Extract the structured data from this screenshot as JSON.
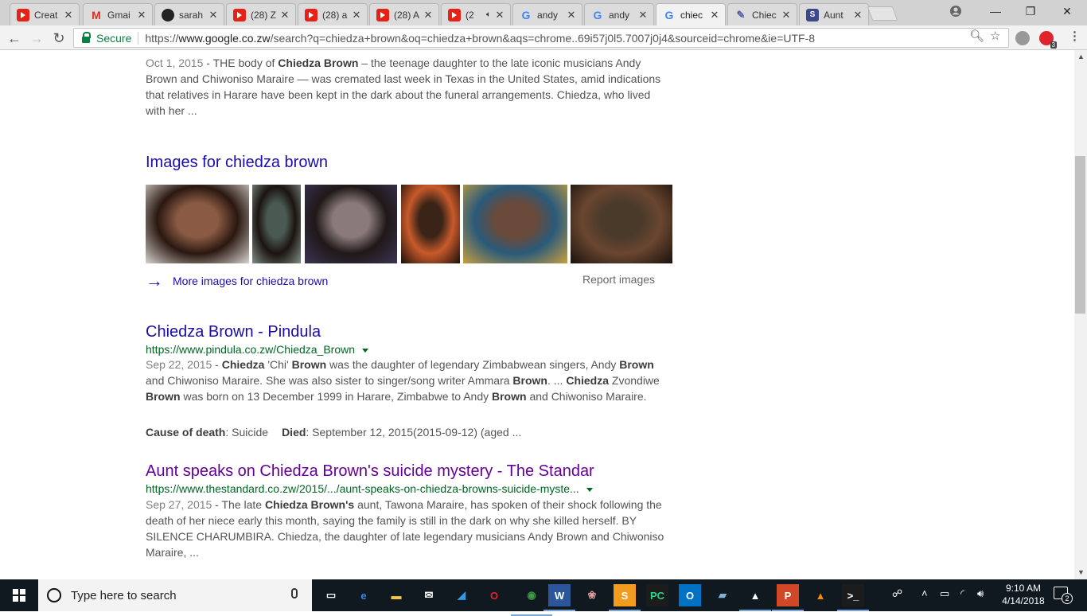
{
  "browser": {
    "tabs": [
      {
        "title": "Creat",
        "icon": "youtube-icon",
        "kind": "yt",
        "active": false
      },
      {
        "title": "Gmai",
        "icon": "gmail-icon",
        "kind": "gm",
        "active": false
      },
      {
        "title": "sarah",
        "icon": "github-icon",
        "kind": "gh",
        "active": false
      },
      {
        "title": "(28) Z",
        "icon": "youtube-icon",
        "kind": "yt",
        "active": false
      },
      {
        "title": "(28) a",
        "icon": "youtube-icon",
        "kind": "yt",
        "active": false
      },
      {
        "title": "(28) A",
        "icon": "youtube-icon",
        "kind": "yt",
        "active": false
      },
      {
        "title": "(2",
        "icon": "youtube-icon",
        "kind": "yt",
        "active": false,
        "audio": true
      },
      {
        "title": "andy",
        "icon": "google-icon",
        "kind": "gg",
        "active": false
      },
      {
        "title": "andy",
        "icon": "google-icon",
        "kind": "gg",
        "active": false
      },
      {
        "title": "chiec",
        "icon": "google-icon",
        "kind": "gg",
        "active": true
      },
      {
        "title": "Chiec",
        "icon": "blog-icon",
        "kind": "bl",
        "active": false
      },
      {
        "title": "Aunt",
        "icon": "standard-icon",
        "kind": "st",
        "active": false
      }
    ],
    "close_glyph": "✕",
    "secure_label": "Secure",
    "url_scheme": "https://",
    "url_host": "www.google.co.zw",
    "url_path": "/search?q=chiedza+brown&oq=chiedza+brown&aqs=chrome..69i57j0l5.7007j0j4&sourceid=chrome&ie=UTF-8",
    "extension_badge": "3"
  },
  "results": {
    "top_snippet": {
      "date": "Oct 1, 2015",
      "parts": [
        {
          "t": " - THE body of ",
          "b": false
        },
        {
          "t": "Chiedza Brown",
          "b": true
        },
        {
          "t": " – the teenage daughter to the late iconic musicians Andy Brown and Chiwoniso Maraire — was cremated last week in Texas in the United States, amid indications that relatives in Harare have been kept in the dark about the funeral arrangements. Chiedza, who lived with her ...",
          "b": false
        }
      ]
    },
    "images": {
      "header": "Images for chiedza brown",
      "more_label": "More images for chiedza brown",
      "report_label": "Report images",
      "thumbs": [
        {
          "name": "image-thumb-1",
          "colors": [
            "#8a5a44",
            "#2a1810",
            "#d8d4d0"
          ]
        },
        {
          "name": "image-thumb-2",
          "colors": [
            "#4a5a52",
            "#1c1410",
            "#7f8f86"
          ]
        },
        {
          "name": "image-thumb-3",
          "colors": [
            "#8a7a7a",
            "#201818",
            "#3a3454"
          ]
        },
        {
          "name": "image-thumb-4",
          "colors": [
            "#3a2418",
            "#c85a2a",
            "#1a0f0a"
          ]
        },
        {
          "name": "image-thumb-5",
          "colors": [
            "#6a4a3a",
            "#2a5a7a",
            "#c8a040"
          ]
        },
        {
          "name": "image-thumb-6",
          "colors": [
            "#4a3a2a",
            "#6a4630",
            "#1a120c"
          ]
        }
      ]
    },
    "items": [
      {
        "title": "Chiedza Brown - Pindula",
        "url": "https://www.pindula.co.zw/Chiedza_Brown",
        "visited": false,
        "date": "Sep 22, 2015",
        "parts": [
          {
            "t": " - ",
            "b": false
          },
          {
            "t": "Chiedza",
            "b": true
          },
          {
            "t": " 'Chi' ",
            "b": false
          },
          {
            "t": "Brown",
            "b": true
          },
          {
            "t": " was the daughter of legendary Zimbabwean singers, Andy ",
            "b": false
          },
          {
            "t": "Brown",
            "b": true
          },
          {
            "t": " and Chiwoniso Maraire. She was also sister to singer/song writer Ammara ",
            "b": false
          },
          {
            "t": "Brown",
            "b": true
          },
          {
            "t": ". ... ",
            "b": false
          },
          {
            "t": "Chiedza",
            "b": true
          },
          {
            "t": " Zvondiwe ",
            "b": false
          },
          {
            "t": "Brown",
            "b": true
          },
          {
            "t": " was born on 13 December 1999 in Harare, Zimbabwe to Andy ",
            "b": false
          },
          {
            "t": "Brown",
            "b": true
          },
          {
            "t": " and Chiwoniso Maraire.",
            "b": false
          }
        ],
        "facts": [
          {
            "label": "Cause of death",
            "value": ": Suicide"
          },
          {
            "label": "Died",
            "value": ": September 12, 2015(2015-09-12) (aged ..."
          }
        ]
      },
      {
        "title": "Aunt speaks on Chiedza Brown's suicide mystery - The Standar",
        "url": "https://www.thestandard.co.zw/2015/.../aunt-speaks-on-chiedza-browns-suicide-myste...",
        "visited": true,
        "date": "Sep 27, 2015",
        "parts": [
          {
            "t": " - The late ",
            "b": false
          },
          {
            "t": "Chiedza Brown's",
            "b": true
          },
          {
            "t": " aunt, Tawona Maraire, has spoken of their shock following the death of her niece early this month, saying the family is still in the dark on why she killed herself. BY SILENCE CHARUMBIRA. Chiedza, the daughter of late legendary musicians Andy Brown and Chiwoniso Maraire, ...",
            "b": false
          }
        ],
        "facts": []
      }
    ]
  },
  "taskbar": {
    "search_placeholder": "Type here to search",
    "apps": [
      {
        "name": "task-view-icon",
        "glyph": "▭",
        "bg": "transparent",
        "run": false
      },
      {
        "name": "edge-icon",
        "glyph": "e",
        "bg": "transparent",
        "color": "#2f8be6",
        "run": false
      },
      {
        "name": "file-explorer-icon",
        "glyph": "▬",
        "bg": "transparent",
        "color": "#f4c542",
        "run": false
      },
      {
        "name": "mail-icon",
        "glyph": "✉",
        "bg": "transparent",
        "run": false
      },
      {
        "name": "azure-icon",
        "glyph": "◢",
        "bg": "transparent",
        "color": "#3a96dd",
        "run": false
      },
      {
        "name": "opera-icon",
        "glyph": "O",
        "bg": "transparent",
        "color": "#e0242e",
        "run": false
      },
      {
        "name": "chrome-icon",
        "glyph": "◉",
        "bg": "transparent",
        "color": "#3d9b47",
        "run": true,
        "active": true
      },
      {
        "name": "word-icon",
        "glyph": "W",
        "bg": "#2b579a",
        "run": true
      },
      {
        "name": "paint-icon",
        "glyph": "❀",
        "bg": "transparent",
        "color": "#e0a0a0",
        "run": false
      },
      {
        "name": "sublime-text-icon",
        "glyph": "S",
        "bg": "#f29c1f",
        "run": true
      },
      {
        "name": "pycharm-icon",
        "glyph": "PC",
        "bg": "#1c1c1c",
        "color": "#21d789",
        "run": false
      },
      {
        "name": "outlook-icon",
        "glyph": "O",
        "bg": "#0072c6",
        "run": false
      },
      {
        "name": "notepad-icon",
        "glyph": "▰",
        "bg": "transparent",
        "color": "#7fb3d5",
        "run": false
      },
      {
        "name": "photos-icon",
        "glyph": "▲",
        "bg": "transparent",
        "color": "#ffffff",
        "run": true
      },
      {
        "name": "powerpoint-icon",
        "glyph": "P",
        "bg": "#d24726",
        "run": true
      },
      {
        "name": "vlc-icon",
        "glyph": "▲",
        "bg": "transparent",
        "color": "#f48b00",
        "run": false
      },
      {
        "name": "terminal-icon",
        "glyph": ">_",
        "bg": "#1c1c1c",
        "run": true
      }
    ],
    "clock_time": "9:10 AM",
    "clock_date": "4/14/2018",
    "notification_count": "2"
  }
}
